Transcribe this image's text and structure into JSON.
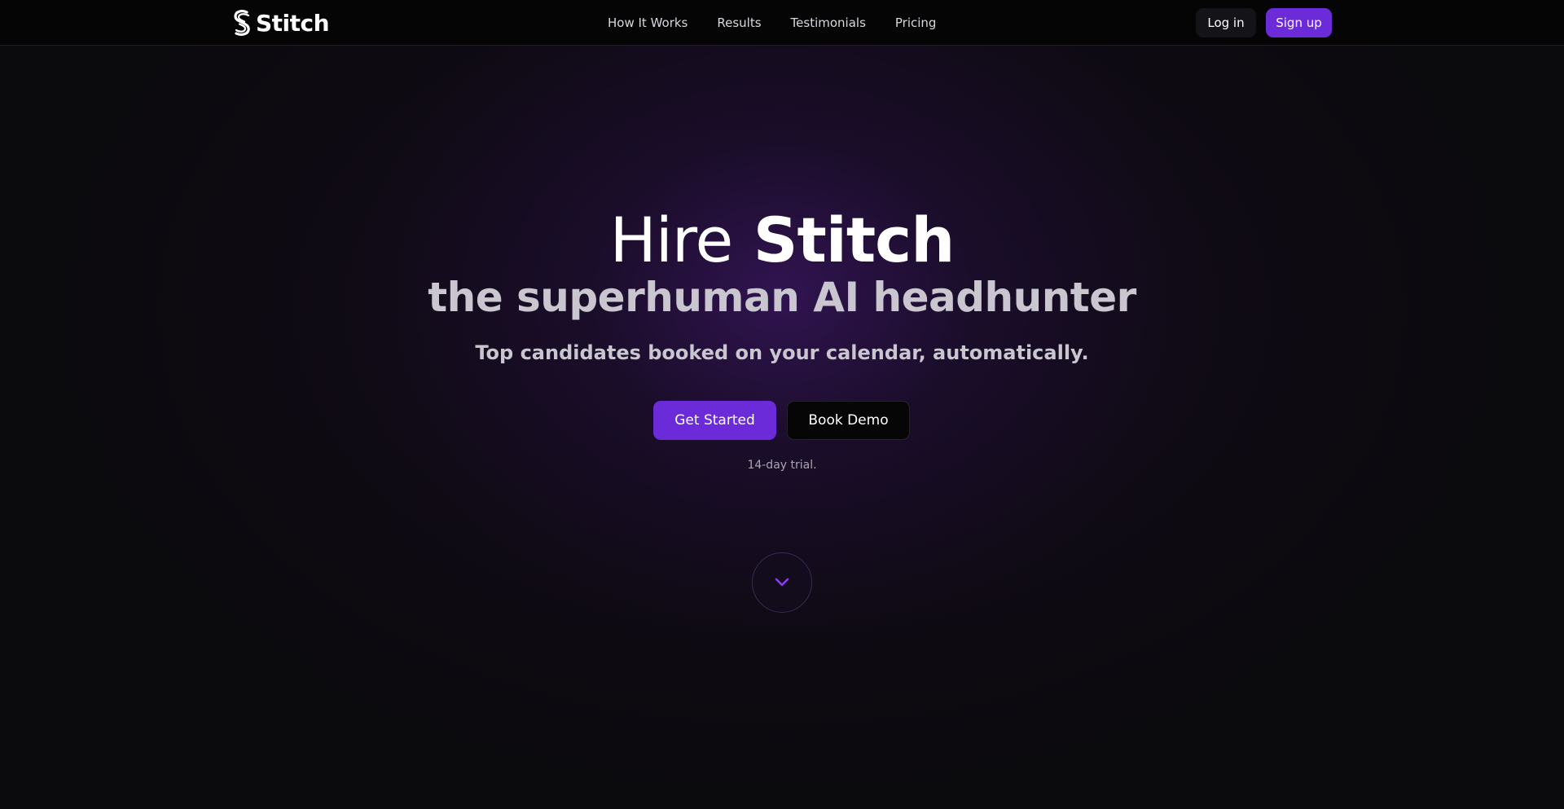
{
  "brand": {
    "name": "Stitch",
    "logo_icon": "stitch-s-logo-icon",
    "accent_color": "#6b2bd9"
  },
  "nav": {
    "items": [
      {
        "label": "How It Works"
      },
      {
        "label": "Results"
      },
      {
        "label": "Testimonials"
      },
      {
        "label": "Pricing"
      }
    ],
    "login_label": "Log in",
    "signup_label": "Sign up"
  },
  "hero": {
    "title_prefix": "Hire",
    "title_brand": "Stitch",
    "subtitle": "the superhuman AI headhunter",
    "tagline": "Top candidates booked on your calendar, automatically.",
    "primary_cta": "Get Started",
    "secondary_cta": "Book Demo",
    "trial_note": "14-day trial.",
    "scroll_icon": "chevron-down-icon"
  }
}
